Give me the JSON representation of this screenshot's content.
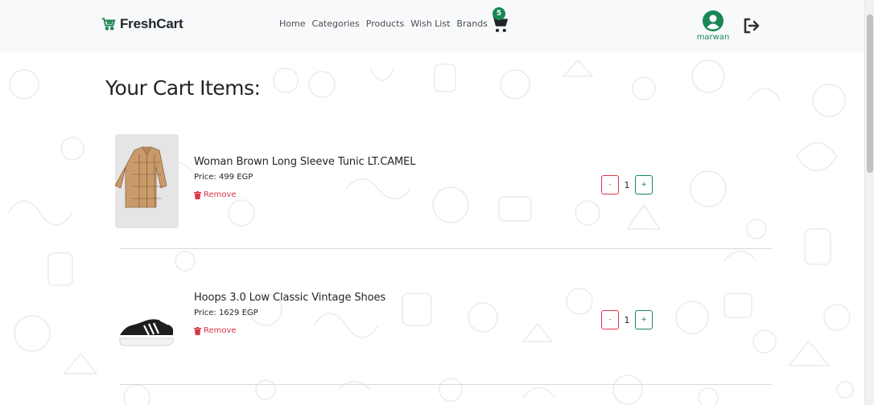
{
  "brand": {
    "name": "FreshCart"
  },
  "nav": {
    "links": [
      "Home",
      "Categories",
      "Products",
      "Wish List",
      "Brands"
    ],
    "cart_count": "5"
  },
  "user": {
    "name": "marwan"
  },
  "cart": {
    "title": "Your Cart Items:",
    "items": [
      {
        "name": "Woman Brown Long Sleeve Tunic LT.CAMEL",
        "price": "Price: 499 EGP",
        "remove_label": "Remove",
        "quantity": "1",
        "minus_label": "-",
        "plus_label": "+"
      },
      {
        "name": "Hoops 3.0 Low Classic Vintage Shoes",
        "price": "Price: 1629 EGP",
        "remove_label": "Remove",
        "quantity": "1",
        "minus_label": "-",
        "plus_label": "+"
      }
    ]
  },
  "colors": {
    "accent": "#198754",
    "danger": "#dc3545",
    "navbar_bg": "#f8f9fa"
  },
  "icons": [
    "cart-logo-icon",
    "cart-icon",
    "user-avatar-icon",
    "logout-icon",
    "trash-icon"
  ]
}
